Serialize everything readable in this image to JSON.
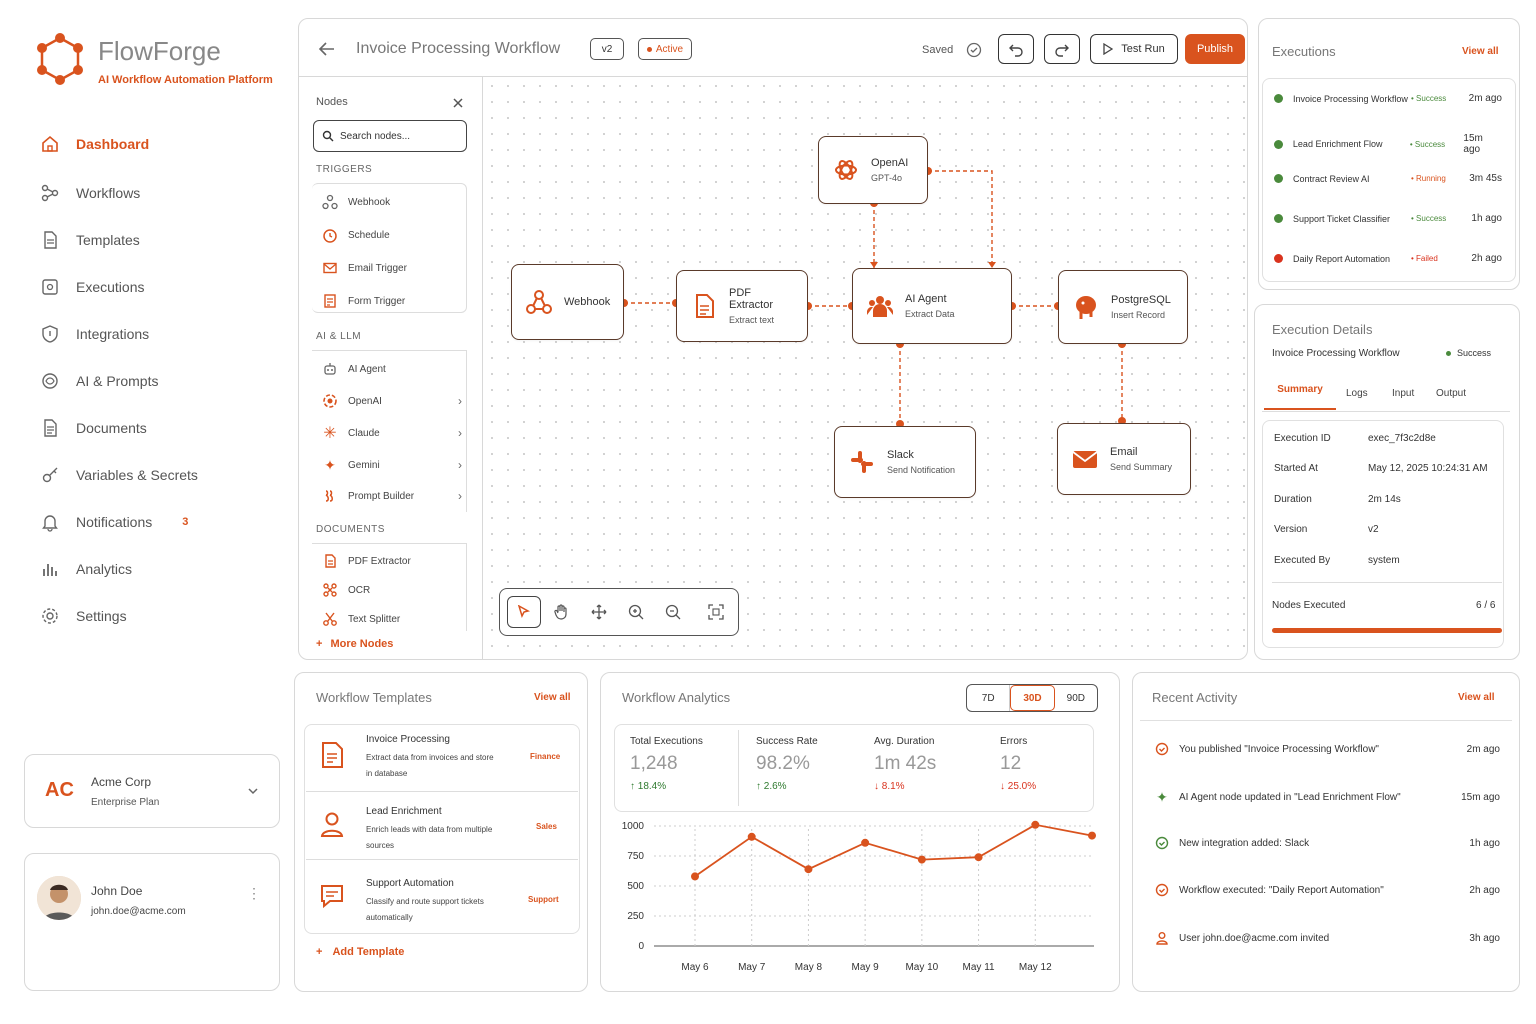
{
  "brand": {
    "name": "FlowForge",
    "tagline": "AI Workflow Automation Platform"
  },
  "sidebar": {
    "items": [
      {
        "label": "Dashboard",
        "icon": "home-icon"
      },
      {
        "label": "Workflows",
        "icon": "workflow-icon"
      },
      {
        "label": "Templates",
        "icon": "template-icon"
      },
      {
        "label": "Executions",
        "icon": "execution-icon"
      },
      {
        "label": "Integrations",
        "icon": "shield-icon"
      },
      {
        "label": "AI & Prompts",
        "icon": "ai-icon"
      },
      {
        "label": "Documents",
        "icon": "document-icon"
      },
      {
        "label": "Variables & Secrets",
        "icon": "key-icon"
      },
      {
        "label": "Notifications",
        "icon": "bell-icon",
        "badge": "3"
      },
      {
        "label": "Analytics",
        "icon": "bar-chart-icon"
      },
      {
        "label": "Settings",
        "icon": "gear-icon"
      }
    ],
    "org": {
      "logo": "AC",
      "name": "Acme Corp",
      "plan": "Enterprise Plan"
    },
    "user": {
      "name": "John Doe",
      "email": "john.doe@acme.com"
    }
  },
  "editor": {
    "title": "Invoice Processing Workflow",
    "version": "v2",
    "status": "Active",
    "saved": "Saved",
    "test_run": "Test Run",
    "publish": "Publish"
  },
  "palette": {
    "title": "Nodes",
    "search_placeholder": "Search nodes...",
    "sections": [
      {
        "title": "TRIGGERS",
        "items": [
          "Webhook",
          "Schedule",
          "Email Trigger",
          "Form Trigger"
        ]
      },
      {
        "title": "AI & LLM",
        "items": [
          "AI Agent",
          "OpenAI",
          "Claude",
          "Gemini",
          "Prompt Builder"
        ]
      },
      {
        "title": "DOCUMENTS",
        "items": [
          "PDF Extractor",
          "OCR",
          "Text Splitter"
        ]
      }
    ],
    "more": "More Nodes"
  },
  "canvas": {
    "nodes": {
      "webhook": {
        "title": "Webhook",
        "sub": ""
      },
      "pdf": {
        "title": "PDF Extractor",
        "sub": "Extract text"
      },
      "openai": {
        "title": "OpenAI",
        "sub": "GPT-4o"
      },
      "agent": {
        "title": "AI Agent",
        "sub": "Extract Data"
      },
      "postgres": {
        "title": "PostgreSQL",
        "sub": "Insert Record"
      },
      "slack": {
        "title": "Slack",
        "sub": "Send Notification"
      },
      "email": {
        "title": "Email",
        "sub": "Send Summary"
      }
    }
  },
  "executions": {
    "title": "Executions",
    "view_all": "View all",
    "rows": [
      {
        "name": "Invoice Processing Workflow",
        "status": "Success",
        "time": "2m ago",
        "color": "#4a8a3c"
      },
      {
        "name": "Lead Enrichment Flow",
        "status": "Success",
        "time": "15m ago",
        "color": "#4a8a3c"
      },
      {
        "name": "Contract Review AI",
        "status": "Running",
        "time": "3m 45s",
        "color": "#4a8a3c"
      },
      {
        "name": "Support Ticket Classifier",
        "status": "Success",
        "time": "1h ago",
        "color": "#4a8a3c"
      },
      {
        "name": "Daily Report Automation",
        "status": "Failed",
        "time": "2h ago",
        "color": "#d9331e"
      }
    ]
  },
  "details": {
    "title": "Execution Details",
    "workflow": "Invoice Processing Workflow",
    "status": "Success",
    "tabs": [
      "Summary",
      "Logs",
      "Input",
      "Output"
    ],
    "rows": [
      {
        "k": "Execution ID",
        "v": "exec_7f3c2d8e"
      },
      {
        "k": "Started At",
        "v": "May 12, 2025 10:24:31 AM"
      },
      {
        "k": "Duration",
        "v": "2m 14s"
      },
      {
        "k": "Version",
        "v": "v2"
      },
      {
        "k": "Executed By",
        "v": "system"
      }
    ],
    "nodes_label": "Nodes Executed",
    "nodes_value": "6 / 6",
    "progress": 1.0
  },
  "templates": {
    "title": "Workflow Templates",
    "view_all": "View all",
    "items": [
      {
        "name": "Invoice Processing",
        "desc1": "Extract data from invoices and store",
        "desc2": "in database",
        "tag": "Finance",
        "icon": "invoice-icon"
      },
      {
        "name": "Lead Enrichment",
        "desc1": "Enrich leads with data from multiple",
        "desc2": "sources",
        "tag": "Sales",
        "icon": "user-icon"
      },
      {
        "name": "Support Automation",
        "desc1": "Classify and route support tickets",
        "desc2": "automatically",
        "tag": "Support",
        "icon": "chat-icon"
      }
    ],
    "add": "Add Template"
  },
  "analytics": {
    "title": "Workflow Analytics",
    "ranges": [
      "7D",
      "30D",
      "90D"
    ],
    "active_range": "30D",
    "stats": [
      {
        "label": "Total Executions",
        "value": "1,248",
        "delta": "↑ 18.4%",
        "color": "#2f7a2f"
      },
      {
        "label": "Success Rate",
        "value": "98.2%",
        "delta": "↑ 2.6%",
        "color": "#2f7a2f"
      },
      {
        "label": "Avg. Duration",
        "value": "1m 42s",
        "delta": "↓ 8.1%",
        "color": "#d9331e"
      },
      {
        "label": "Errors",
        "value": "12",
        "delta": "↓ 25.0%",
        "color": "#d9331e"
      }
    ]
  },
  "chart_data": {
    "type": "line",
    "categories": [
      "May 6",
      "May 7",
      "May 8",
      "May 9",
      "May 10",
      "May 11",
      "May 12"
    ],
    "series": [
      {
        "values": [
          580,
          910,
          640,
          860,
          720,
          740,
          1010,
          920
        ]
      }
    ],
    "ylim": [
      0,
      1000
    ],
    "yticks": [
      "0",
      "250",
      "500",
      "750",
      "1000"
    ],
    "grid": true
  },
  "activity": {
    "title": "Recent Activity",
    "view_all": "View all",
    "items": [
      {
        "text": "You published \"Invoice Processing Workflow\"",
        "time": "2m ago",
        "icon": "check-circle-icon"
      },
      {
        "text": "AI Agent node updated in \"Lead Enrichment Flow\"",
        "time": "15m ago",
        "icon": "sparkle-icon"
      },
      {
        "text": "New integration added: Slack",
        "time": "1h ago",
        "icon": "check-circle-icon"
      },
      {
        "text": "Workflow executed: \"Daily Report Automation\"",
        "time": "2h ago",
        "icon": "check-circle-icon"
      },
      {
        "text": "User john.doe@acme.com invited",
        "time": "3h ago",
        "icon": "user-icon"
      }
    ]
  },
  "colors": {
    "accent": "#d9531e",
    "success": "#4a8a3c",
    "error": "#d9331e"
  }
}
